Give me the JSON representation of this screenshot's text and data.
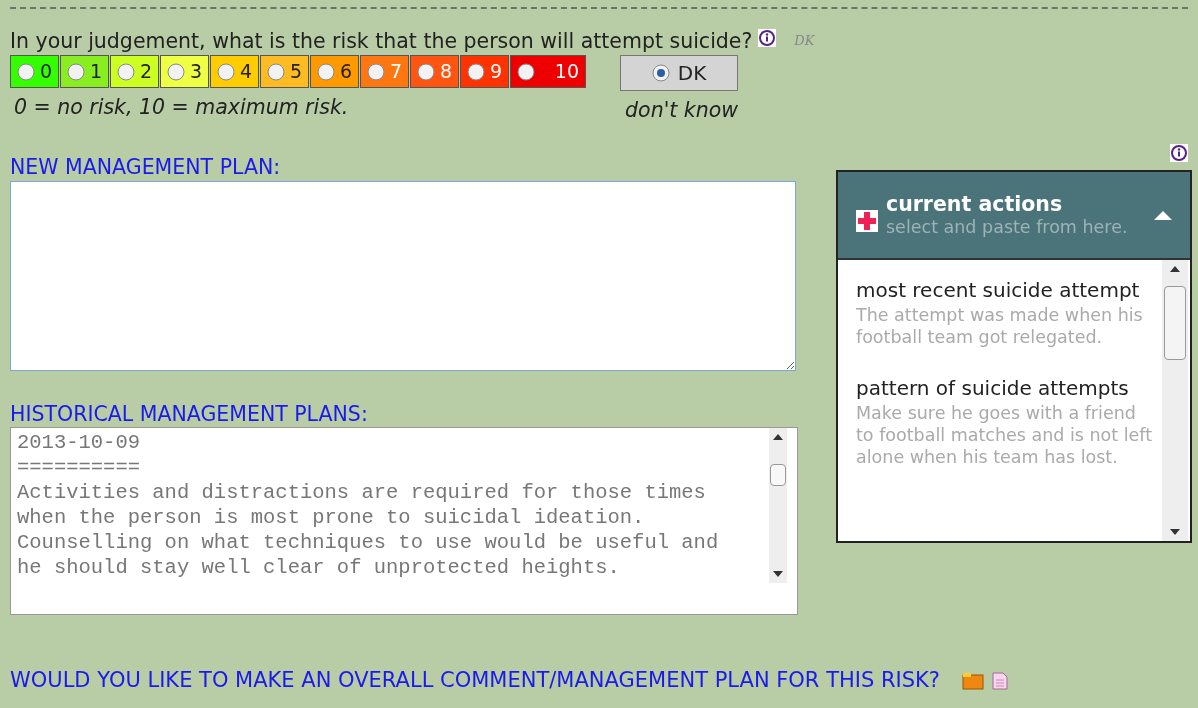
{
  "question": {
    "text": "In your judgement, what is the risk that the person will attempt suicide?",
    "hint": "DK"
  },
  "scale": [
    {
      "label": "0",
      "color": "#33ff00",
      "selected": false
    },
    {
      "label": "1",
      "color": "#88ee22",
      "selected": false
    },
    {
      "label": "2",
      "color": "#ccff22",
      "selected": false
    },
    {
      "label": "3",
      "color": "#eeff44",
      "selected": false
    },
    {
      "label": "4",
      "color": "#ffcc00",
      "selected": false
    },
    {
      "label": "5",
      "color": "#ffbb22",
      "selected": false
    },
    {
      "label": "6",
      "color": "#ff9900",
      "selected": false
    },
    {
      "label": "7",
      "color": "#ff7711",
      "selected": false
    },
    {
      "label": "8",
      "color": "#ff5511",
      "selected": false
    },
    {
      "label": "9",
      "color": "#ff3300",
      "selected": false
    },
    {
      "label": "10",
      "color": "#ee0000",
      "selected": false
    }
  ],
  "dont_know": {
    "label": "DK",
    "selected": true,
    "caption": "don't know"
  },
  "legend": "0 = no risk, 10 = maximum risk.",
  "new_plan": {
    "label": "NEW MANAGEMENT PLAN:"
  },
  "historical": {
    "label": "HISTORICAL MANAGEMENT PLANS:",
    "lines": [
      "2013-10-09",
      "==========",
      "Activities and distractions are required for those times",
      "when the person is most prone to suicidal ideation.",
      "Counselling on what techniques to use would be useful and",
      "he should stay well clear of unprotected heights."
    ]
  },
  "current_actions": {
    "title": "current actions",
    "subtitle": "select and paste from here.",
    "expanded": true,
    "items": [
      {
        "title": "most recent suicide attempt",
        "text": "The attempt was made when his football team got relegated."
      },
      {
        "title": "pattern of suicide attempts",
        "text": "Make sure he goes with a friend to football matches and is not left alone when his team has lost."
      }
    ]
  },
  "overall": {
    "label": "WOULD YOU LIKE TO MAKE AN OVERALL COMMENT/MANAGEMENT PLAN FOR THIS RISK?"
  }
}
